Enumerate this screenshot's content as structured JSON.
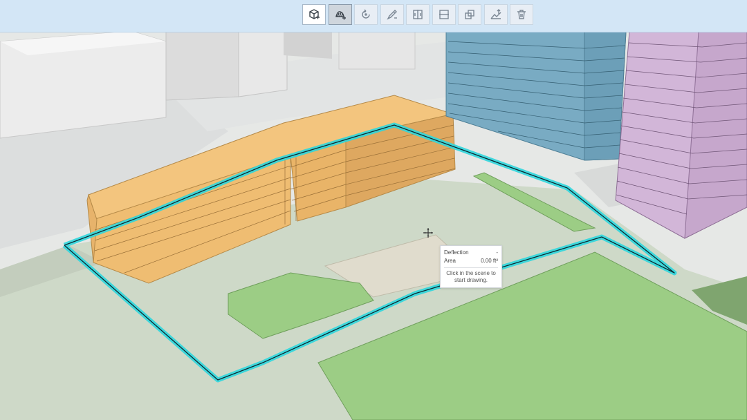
{
  "toolbar": {
    "tools": [
      {
        "icon": "cube-add-icon",
        "state": "active"
      },
      {
        "icon": "polygon-extrude-icon",
        "state": "selected"
      },
      {
        "icon": "rotate-icon",
        "state": "normal"
      },
      {
        "icon": "reshape-icon",
        "state": "normal"
      },
      {
        "icon": "split-vertical-icon",
        "state": "normal"
      },
      {
        "icon": "split-horizontal-icon",
        "state": "normal"
      },
      {
        "icon": "merge-icon",
        "state": "normal"
      },
      {
        "icon": "elevation-icon",
        "state": "normal"
      },
      {
        "icon": "trash-icon",
        "state": "normal"
      }
    ]
  },
  "tooltip": {
    "deflection_label": "Deflection",
    "deflection_value": "-",
    "area_label": "Area",
    "area_value": "0.00 ft²",
    "hint_line1": "Click in the scene to",
    "hint_line2": "start drawing."
  },
  "colors": {
    "toolbar_band": "#d3e6f6",
    "outline": "#2fd6dd",
    "building_orange": "#f0c078",
    "building_blue": "#79abc3",
    "building_purple": "#d2b6d8",
    "grass": "#9ccd85"
  }
}
